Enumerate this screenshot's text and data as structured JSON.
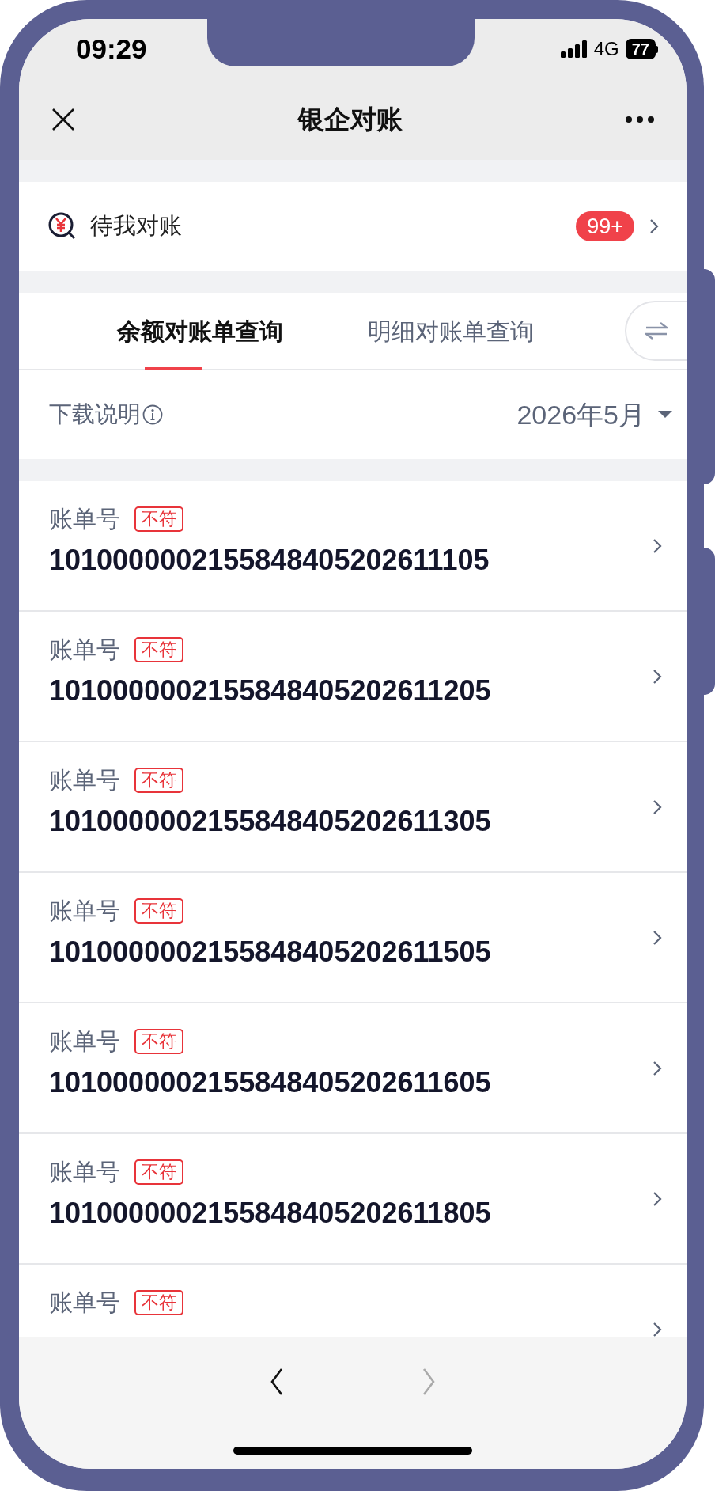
{
  "status_bar": {
    "time": "09:29",
    "network": "4G",
    "battery": "77"
  },
  "nav_bar": {
    "title": "银企对账"
  },
  "pending": {
    "label": "待我对账",
    "badge": "99+"
  },
  "tabs": [
    {
      "label": "余额对账单查询",
      "selected": true
    },
    {
      "label": "明细对账单查询",
      "selected": false
    }
  ],
  "filter": {
    "help": "下载说明",
    "month": "2026年5月"
  },
  "bills": [
    {
      "label": "账单号",
      "tag": "不符",
      "number": "1010000002155848405202611105"
    },
    {
      "label": "账单号",
      "tag": "不符",
      "number": "1010000002155848405202611205"
    },
    {
      "label": "账单号",
      "tag": "不符",
      "number": "1010000002155848405202611305"
    },
    {
      "label": "账单号",
      "tag": "不符",
      "number": "1010000002155848405202611505"
    },
    {
      "label": "账单号",
      "tag": "不符",
      "number": "1010000002155848405202611605"
    },
    {
      "label": "账单号",
      "tag": "不符",
      "number": "1010000002155848405202611805"
    },
    {
      "label": "账单号",
      "tag": "不符"
    }
  ],
  "toolbar": [
    {
      "kind": "back",
      "disabled": false
    },
    {
      "kind": "forward",
      "disabled": true
    }
  ]
}
